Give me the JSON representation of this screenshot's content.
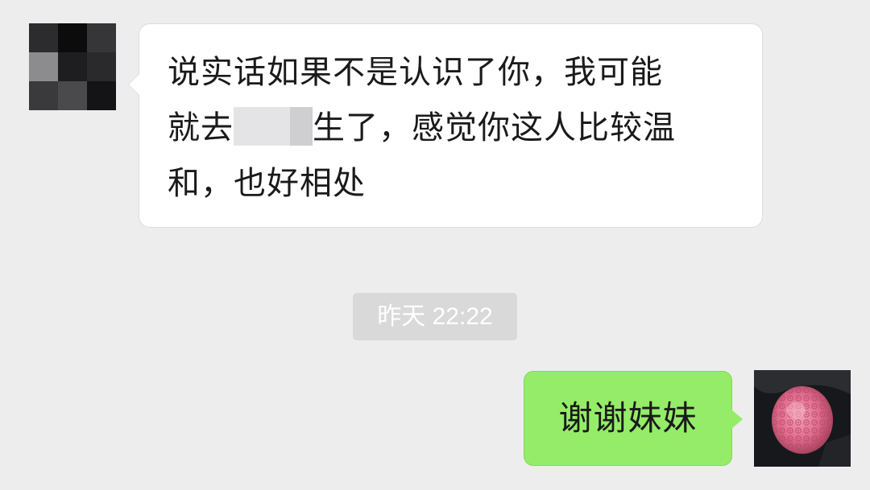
{
  "messages": [
    {
      "direction": "incoming",
      "lines": [
        "说实话如果不是认识了你，我可能",
        [
          "就去",
          "生了，感觉你这人比较温"
        ],
        "和，也好相处"
      ]
    },
    {
      "direction": "outgoing",
      "text": "谢谢妹妹"
    }
  ],
  "timestamp": "昨天 22:22",
  "colors": {
    "background": "#ededed",
    "incoming_bubble": "#ffffff",
    "outgoing_bubble": "#95ec69",
    "timestamp_bg": "#d9d9d9"
  },
  "icons": {
    "incoming_avatar": "pixelated-avatar-icon",
    "outgoing_avatar": "rose-bouquet-avatar-icon"
  }
}
